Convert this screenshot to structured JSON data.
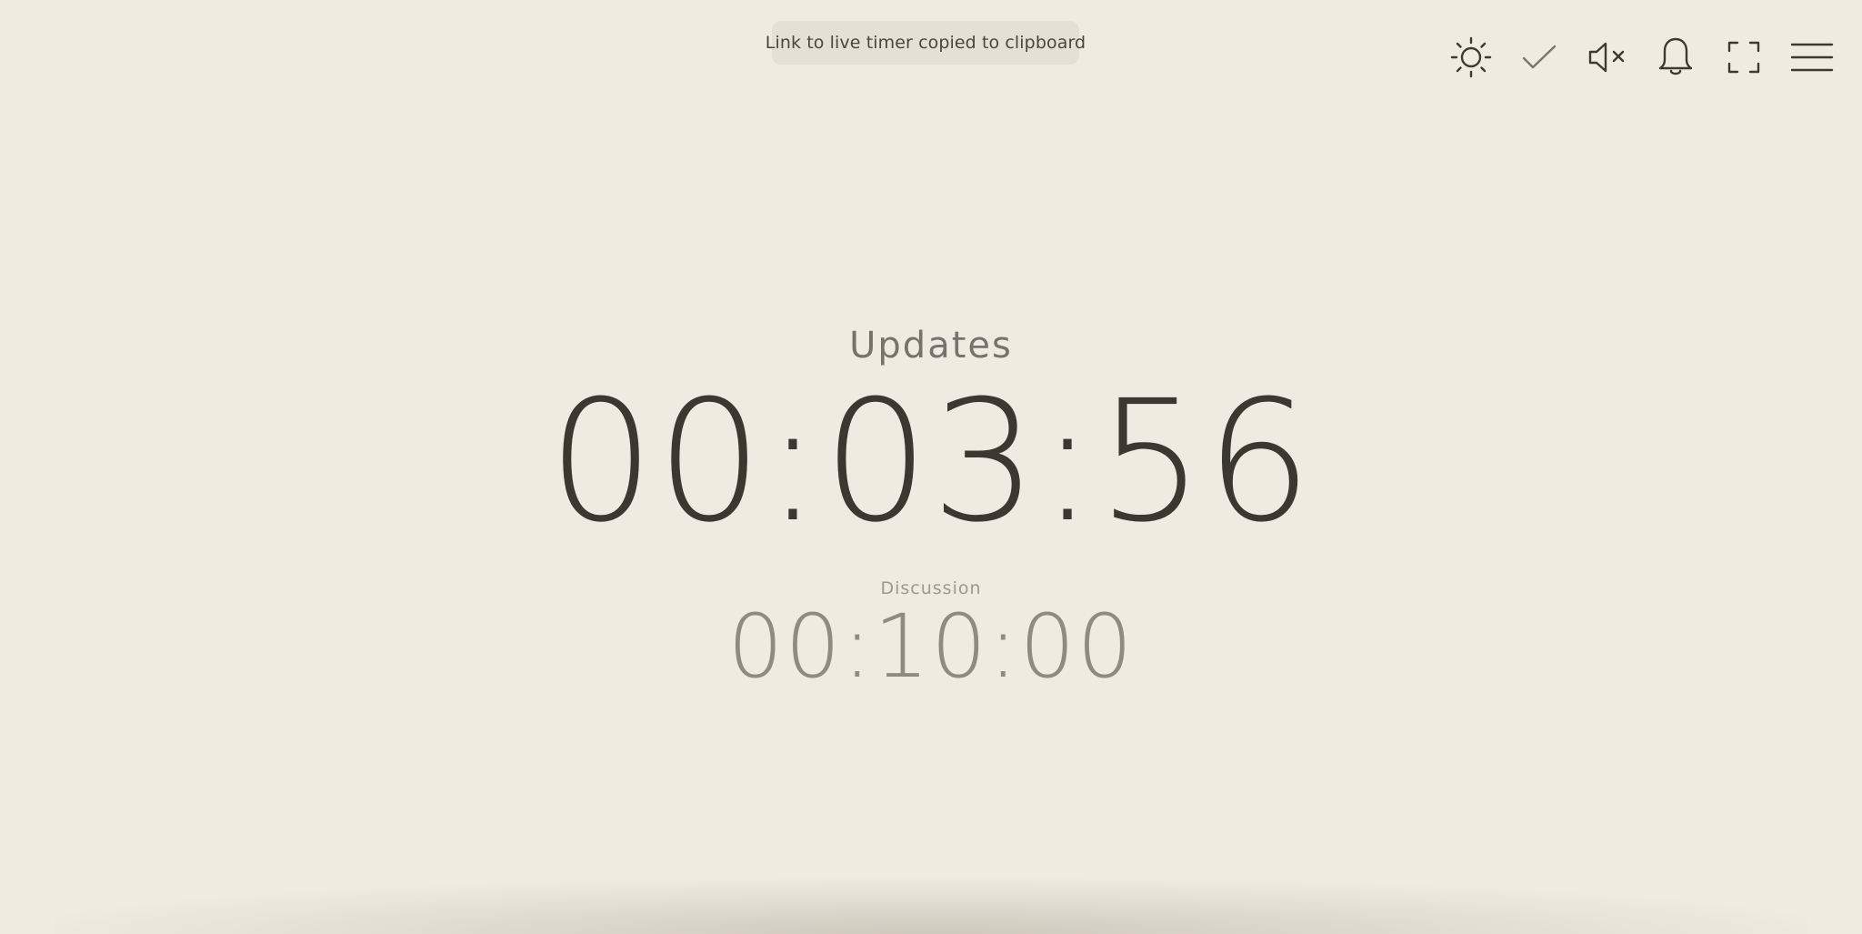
{
  "toast": {
    "message": "Link to live timer copied to clipboard"
  },
  "toolbar": {
    "icons": [
      "sun-icon",
      "check-icon",
      "speaker-muted-icon",
      "bell-icon",
      "fullscreen-icon",
      "hamburger-menu-icon"
    ]
  },
  "timer": {
    "current_label": "Updates",
    "current_time": "00:03:56",
    "next_label": "Discussion",
    "next_time": "00:10:00"
  },
  "colors": {
    "background": "#efebe1",
    "text_primary": "#3b382f",
    "text_secondary": "#8f8b81",
    "toast_bg": "#e5e0d6"
  }
}
